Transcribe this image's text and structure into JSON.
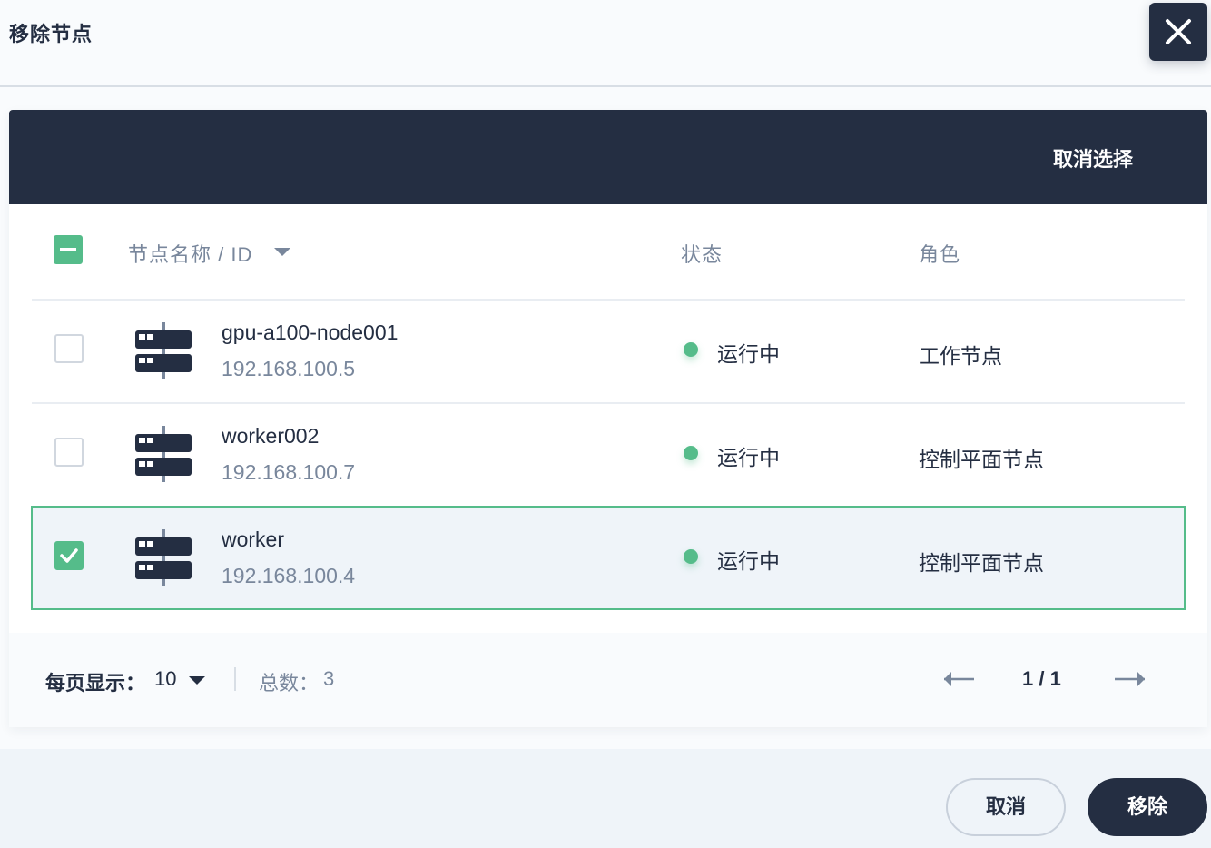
{
  "dialog": {
    "title": "移除节点"
  },
  "toolbar": {
    "clear_selection": "取消选择"
  },
  "table": {
    "headers": {
      "name": "节点名称 / ID",
      "status": "状态",
      "role": "角色"
    },
    "rows": [
      {
        "name": "gpu-a100-node001",
        "ip": "192.168.100.5",
        "status": "运行中",
        "role": "工作节点",
        "selected": false
      },
      {
        "name": "worker002",
        "ip": "192.168.100.7",
        "status": "运行中",
        "role": "控制平面节点",
        "selected": false
      },
      {
        "name": "worker",
        "ip": "192.168.100.4",
        "status": "运行中",
        "role": "控制平面节点",
        "selected": true
      }
    ]
  },
  "pagination": {
    "page_size_label": "每页显示：",
    "page_size": "10",
    "total_label": "总数：",
    "total": "3",
    "page_indicator": "1 / 1"
  },
  "buttons": {
    "cancel": "取消",
    "remove": "移除"
  },
  "icons": {
    "close": "close-icon",
    "node": "server-icon",
    "check": "check-icon",
    "caret": "caret-down-icon",
    "prev": "arrow-left-icon",
    "next": "arrow-right-icon"
  },
  "colors": {
    "primary_dark": "#242e42",
    "success": "#55bc8a",
    "muted": "#79879c"
  }
}
